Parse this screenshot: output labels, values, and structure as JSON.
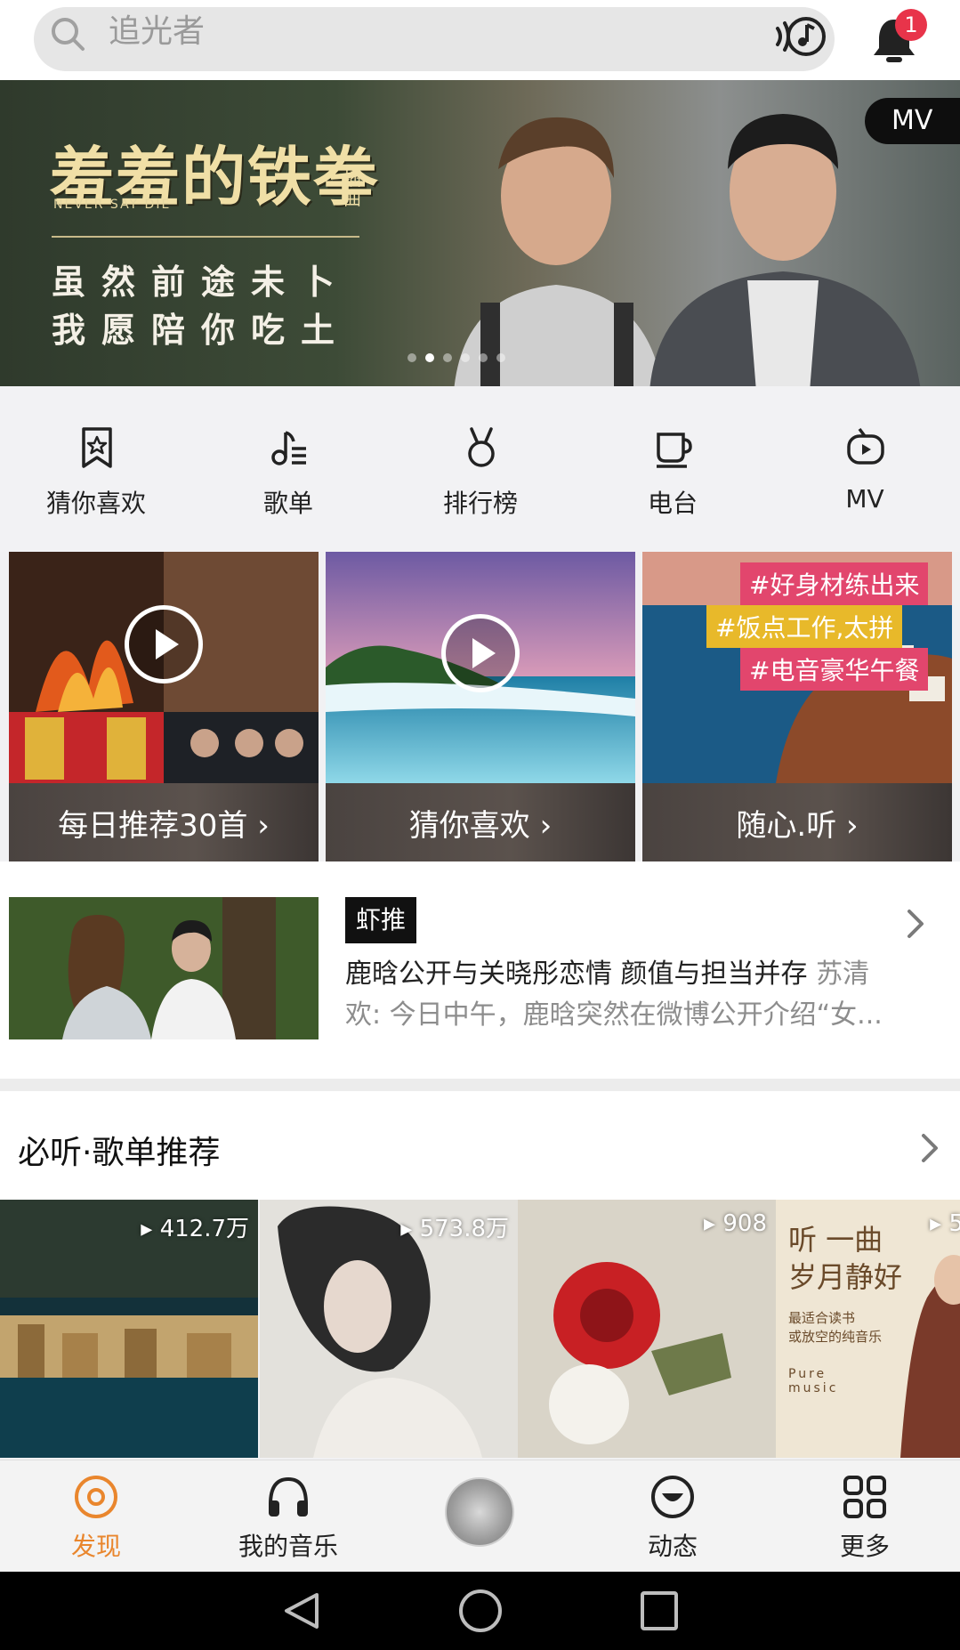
{
  "search": {
    "placeholder": "追光者"
  },
  "notifications": {
    "badge_count": "1"
  },
  "banner": {
    "title": "羞羞的铁拳",
    "subtitle": "NEVER SAY DIE",
    "tag": "插曲",
    "line1": "虽然前途未卜",
    "line2": "我愿陪你吃土",
    "badge": "MV",
    "slides_total": 6,
    "active_slide": 2
  },
  "categories": [
    {
      "label": "猜你喜欢",
      "icon": "star-bookmark-icon"
    },
    {
      "label": "歌单",
      "icon": "playlist-note-icon"
    },
    {
      "label": "排行榜",
      "icon": "medal-icon"
    },
    {
      "label": "电台",
      "icon": "cup-icon"
    },
    {
      "label": "MV",
      "icon": "tv-play-icon"
    }
  ],
  "feature_cards": [
    {
      "label": "每日推荐30首 ›"
    },
    {
      "label": "猜你喜欢 ›"
    },
    {
      "label": "随心.听 ›",
      "tags": [
        "#好身材练出来",
        "#饭点工作,太拼",
        "#电音豪华午餐"
      ]
    }
  ],
  "news": {
    "badge": "虾推",
    "title": "鹿晗公开与关晓彤恋情 颜值与担当并存",
    "author": "苏清",
    "summary": "欢: 今日中午，鹿晗突然在微博公开介绍“女..."
  },
  "playlist_section": {
    "title": "必听·歌单推荐",
    "items": [
      {
        "count": "412.7万"
      },
      {
        "count": "573.8万"
      },
      {
        "count": "908"
      },
      {
        "count": "5",
        "cover_text_1": "听 一曲",
        "cover_text_2": "岁月静好",
        "cover_text_3": "最适合读书\n或放空的纯音乐",
        "cover_text_4": "Pure music"
      }
    ]
  },
  "bottom_nav": [
    {
      "label": "发现",
      "active": true
    },
    {
      "label": "我的音乐",
      "active": false
    },
    {
      "label": "",
      "active": false
    },
    {
      "label": "动态",
      "active": false
    },
    {
      "label": "更多",
      "active": false
    }
  ],
  "colors": {
    "accent": "#e9862d",
    "badge_red": "#e8344a",
    "dark": "#111111"
  }
}
